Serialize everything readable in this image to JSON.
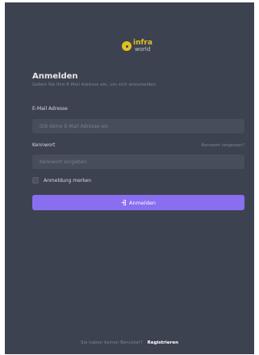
{
  "logo": {
    "line1": "infra",
    "line2": "world"
  },
  "title": "Anmelden",
  "subtitle": "Geben Sie Ihre E-Mail Adresse ein, um sich anzumelden.",
  "email": {
    "label": "E-Mail Adresse",
    "placeholder": "Gib deine E-Mail Adresse ein",
    "value": ""
  },
  "password": {
    "label": "Kennwort",
    "forgot_link": "Kennwort vergessen?",
    "placeholder": "Kennwort eingeben",
    "value": ""
  },
  "remember": {
    "label": "Anmeldung merken",
    "checked": false
  },
  "submit_label": "Anmelden",
  "footer": {
    "text": "Sie haben keinen Benutzer?",
    "register_link": "Registrieren"
  },
  "colors": {
    "panel_background": "#3d4250",
    "accent": "#8a6ef0",
    "logo_yellow": "#e2c11f"
  },
  "icons": {
    "logo": "infraworld-logo-icon",
    "submit": "login-arrow-icon"
  }
}
